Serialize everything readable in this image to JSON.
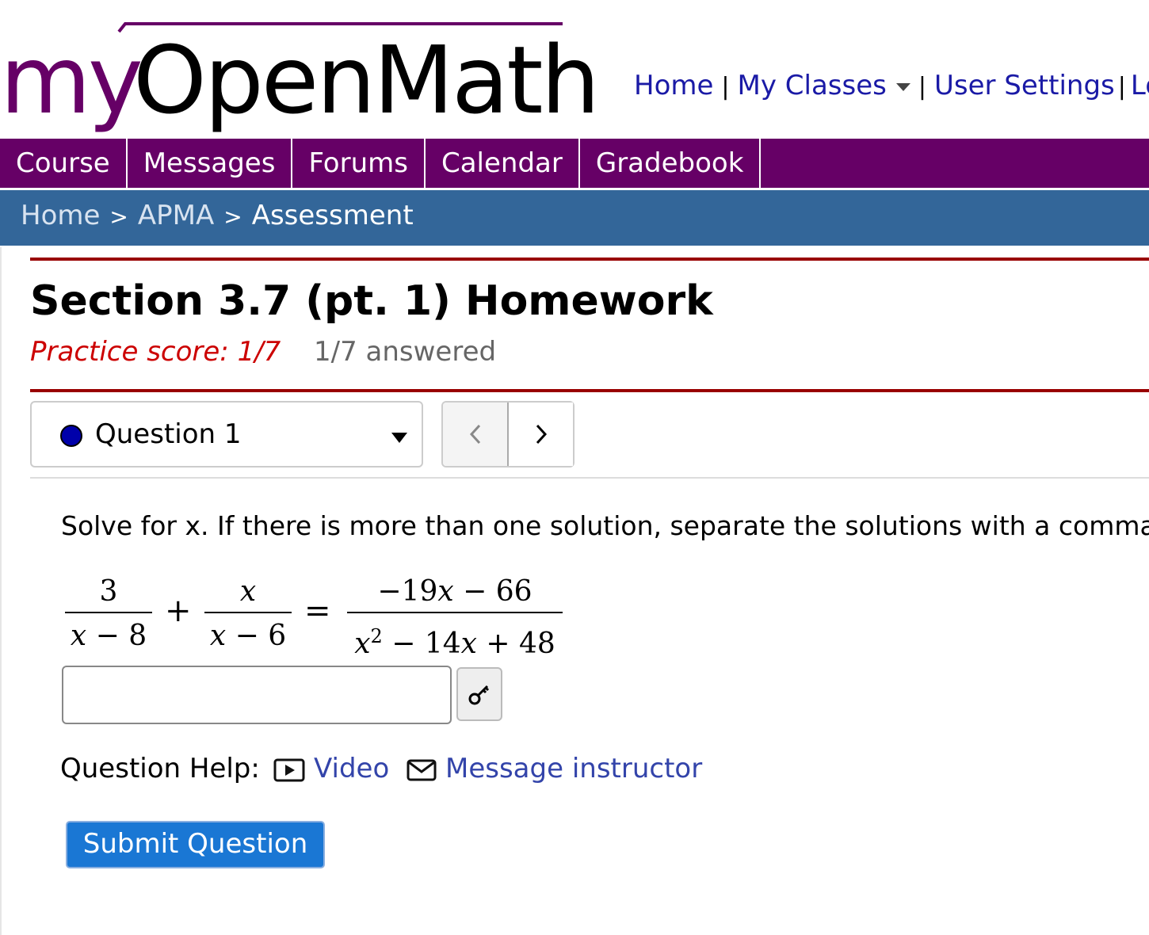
{
  "header": {
    "logo": {
      "part1": "my",
      "part2": "OpenMath",
      "brand_color": "#660066"
    },
    "links": {
      "home": "Home",
      "my_classes": "My Classes",
      "user_settings": "User Settings",
      "logout": "Lo"
    },
    "separator": "|"
  },
  "nav": {
    "color": "#660066",
    "tabs": [
      "Course",
      "Messages",
      "Forums",
      "Calendar",
      "Gradebook"
    ]
  },
  "breadcrumb": {
    "color": "#336699",
    "items": [
      "Home",
      "APMA",
      "Assessment"
    ],
    "separator": ">"
  },
  "assessment": {
    "title": "Section 3.7 (pt. 1) Homework",
    "practice_score": "Practice score: 1/7",
    "answered": "1/7 answered",
    "accent_color": "#990000"
  },
  "question_nav": {
    "selected": "Question 1",
    "prev_icon": "chevron-left-icon",
    "next_icon": "chevron-right-icon",
    "status_dot_color": "#0000aa"
  },
  "question": {
    "text": "Solve for x. If there is more than one solution, separate the solutions with a comma.",
    "equation": {
      "term1": {
        "num": "3",
        "den_var": "x",
        "den_rest": " − 8"
      },
      "plus": "+",
      "term2": {
        "num_var": "x",
        "den_var": "x",
        "den_rest": " − 6"
      },
      "equals": "=",
      "rhs": {
        "num_sign": "−",
        "num_coef": "19",
        "num_var": "x",
        "num_rest": " − 66",
        "den_var": "x",
        "den_exp": "2",
        "den_rest1": " − 14",
        "den_var2": "x",
        "den_rest2": " + 48"
      }
    },
    "answer_value": "",
    "key_icon": "key-icon"
  },
  "help": {
    "label": "Question Help:",
    "video": "Video",
    "message": "Message instructor"
  },
  "submit_label": "Submit Question",
  "submit_color": "#1a77d4"
}
